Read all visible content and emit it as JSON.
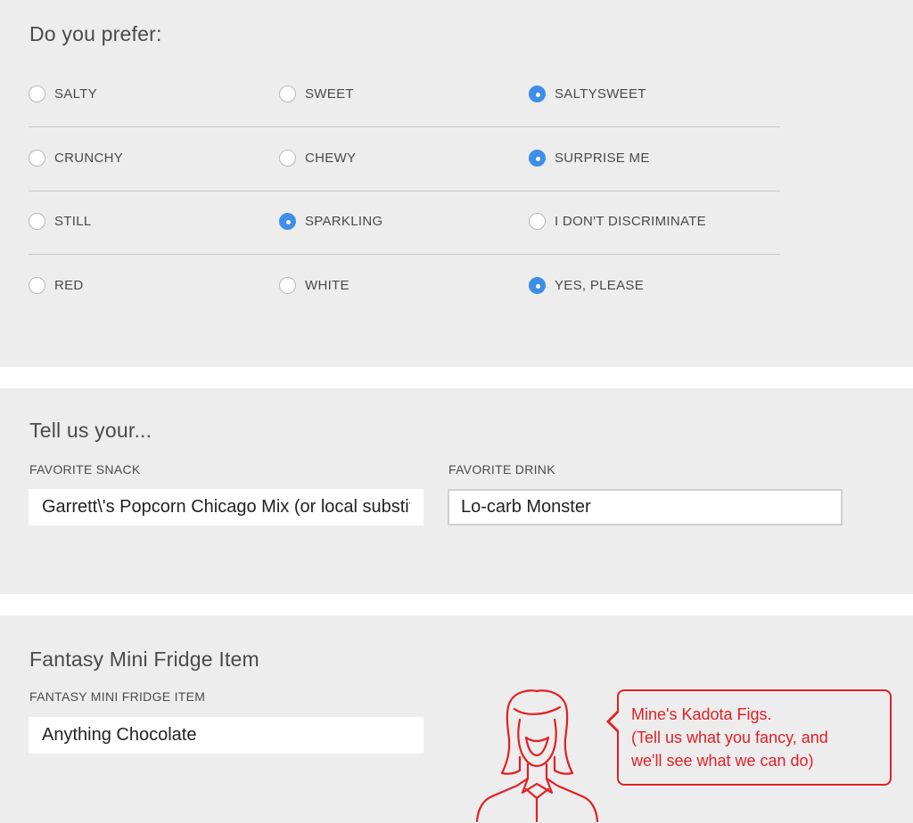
{
  "preferences": {
    "title": "Do you prefer:",
    "rows": [
      {
        "options": [
          {
            "label": "SALTY",
            "selected": false
          },
          {
            "label": "SWEET",
            "selected": false
          },
          {
            "label": "SALTYSWEET",
            "selected": true
          }
        ]
      },
      {
        "options": [
          {
            "label": "CRUNCHY",
            "selected": false
          },
          {
            "label": "CHEWY",
            "selected": false
          },
          {
            "label": "SURPRISE ME",
            "selected": true
          }
        ]
      },
      {
        "options": [
          {
            "label": "STILL",
            "selected": false
          },
          {
            "label": "SPARKLING",
            "selected": true
          },
          {
            "label": "I DON'T DISCRIMINATE",
            "selected": false
          }
        ]
      },
      {
        "options": [
          {
            "label": "RED",
            "selected": false
          },
          {
            "label": "WHITE",
            "selected": false
          },
          {
            "label": "YES, PLEASE",
            "selected": true
          }
        ]
      }
    ]
  },
  "favorites": {
    "title": "Tell us your...",
    "snack": {
      "label": "FAVORITE SNACK",
      "value": "Garrett\\'s Popcorn Chicago Mix (or local substitute)"
    },
    "drink": {
      "label": "FAVORITE DRINK",
      "value": "Lo-carb Monster"
    }
  },
  "fantasy": {
    "title": "Fantasy Mini Fridge Item",
    "label": "FANTASY MINI FRIDGE ITEM",
    "value": "Anything Chocolate",
    "tip_lines": [
      "Mine's Kadota Figs.",
      "(Tell us what you fancy, and",
      "we'll see what we can do)"
    ]
  },
  "colors": {
    "accent_radio": "#3d8ee8",
    "tip_red": "#e21f26",
    "panel_bg": "#ededed"
  },
  "icons": {
    "avatar": "person-outline-icon"
  }
}
